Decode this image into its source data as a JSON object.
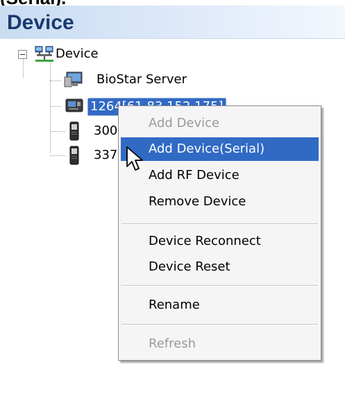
{
  "top_fragment": "(Serial).",
  "panel": {
    "title": "Device"
  },
  "tree": {
    "root": {
      "label": "Device",
      "icon": "network-icon",
      "expanded": true
    },
    "children": [
      {
        "label": "BioStar Server",
        "icon": "server-monitor-icon",
        "selected": false
      },
      {
        "label": "1264[61.83.152.175]",
        "icon": "biometric-terminal-icon",
        "selected": true
      },
      {
        "label": "300",
        "icon": "card-reader-icon",
        "selected": false
      },
      {
        "label": "337",
        "icon": "card-reader-icon",
        "selected": false
      }
    ]
  },
  "context_menu": {
    "items": [
      {
        "label": "Add Device",
        "enabled": false
      },
      {
        "label": "Add Device(Serial)",
        "enabled": true,
        "highlighted": true
      },
      {
        "label": "Add RF Device",
        "enabled": true
      },
      {
        "label": "Remove Device",
        "enabled": true
      },
      {
        "label": "Device Reconnect",
        "enabled": true
      },
      {
        "label": "Device Reset",
        "enabled": true
      },
      {
        "label": "Rename",
        "enabled": true
      },
      {
        "label": "Refresh",
        "enabled": false
      }
    ]
  },
  "colors": {
    "selection": "#316ac5",
    "header_title": "#1a3a6e",
    "disabled_text": "#9a9a9a",
    "menu_background": "#f5f5f5"
  }
}
